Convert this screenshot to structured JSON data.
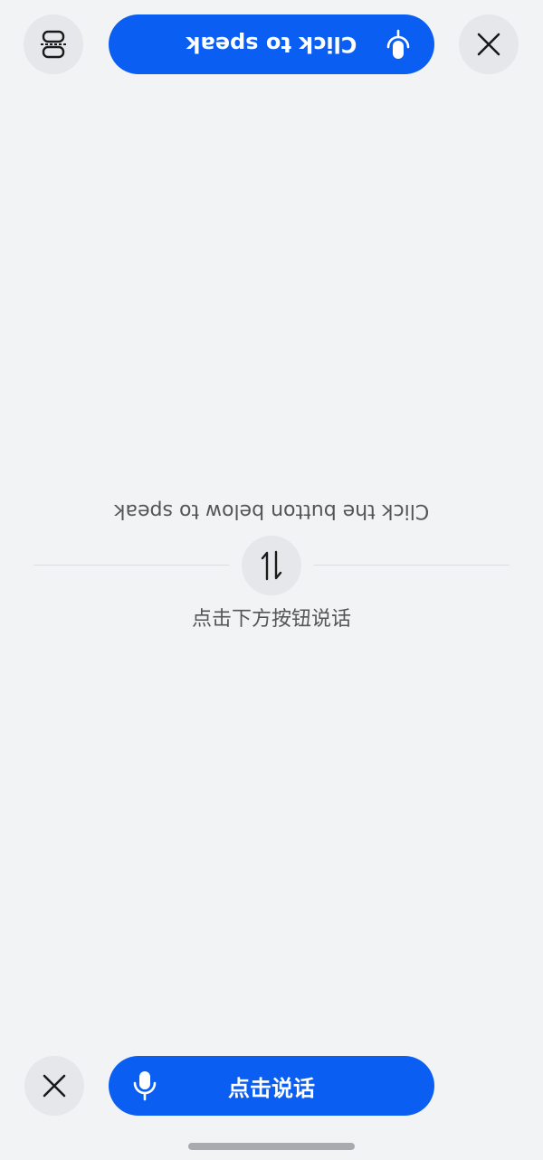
{
  "top_panel": {
    "speak_button_label": "Click to speak",
    "prompt_text": "Click the button below to speak"
  },
  "bottom_panel": {
    "speak_button_label": "点击说话",
    "prompt_text": "点击下方按钮说话"
  },
  "icons": {
    "top_close": "close-icon",
    "top_layout": "split-layout-icon",
    "top_mic": "microphone-icon",
    "swap": "swap-direction-icon",
    "bottom_close": "close-icon",
    "bottom_mic": "microphone-icon"
  },
  "colors": {
    "background": "#f2f3f5",
    "accent": "#0a5ff2",
    "circle_button": "#e6e7ea",
    "text": "#555555"
  }
}
